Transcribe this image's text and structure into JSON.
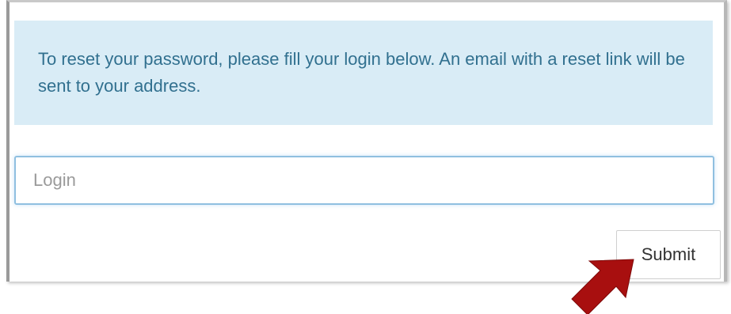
{
  "reset_form": {
    "info_message": "To reset your password, please fill your login below. An email with a reset link will be sent to your address.",
    "login_placeholder": "Login",
    "login_value": "",
    "submit_label": "Submit"
  },
  "annotation": {
    "arrow_icon": "pointer-arrow-icon",
    "arrow_color": "#a80f0f"
  },
  "colors": {
    "info_background": "#d9ecf6",
    "info_text": "#31708f",
    "input_border": "#8fbfe0"
  }
}
